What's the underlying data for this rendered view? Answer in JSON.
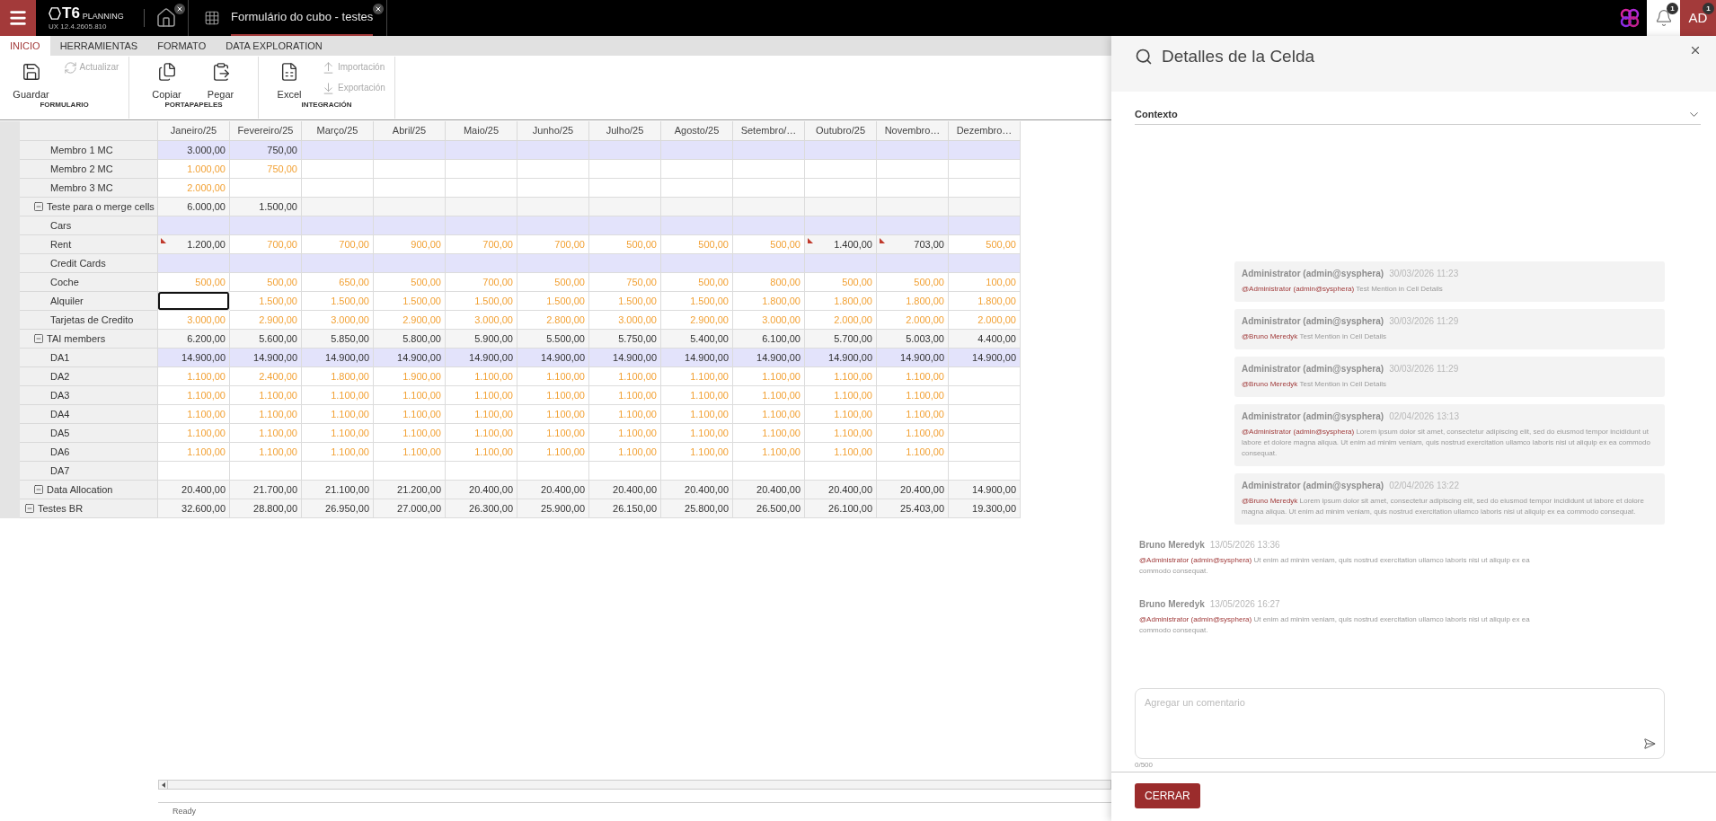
{
  "topbar": {
    "logo": {
      "mark": "T6",
      "name": "PLANNING",
      "version": "UX 12.4.2605.810"
    },
    "tabs": [
      {
        "kind": "home",
        "selected": false
      },
      {
        "kind": "form",
        "label": "Formulário do cubo - testes",
        "selected": true
      }
    ],
    "notifications": {
      "count": "1"
    },
    "user": {
      "initials": "AD",
      "count": "1"
    }
  },
  "ribbon": {
    "tabs": [
      {
        "label": "INICIO",
        "selected": true
      },
      {
        "label": "HERRAMIENTAS",
        "selected": false
      },
      {
        "label": "FORMATO",
        "selected": false
      },
      {
        "label": "DATA EXPLORATION",
        "selected": false
      }
    ],
    "groups": [
      {
        "label": "FORMULARIO",
        "buttons": [
          {
            "kind": "save",
            "label": "Guardar",
            "disabled": false
          },
          {
            "kind": "refresh",
            "label": "Actualizar",
            "disabled": true
          }
        ]
      },
      {
        "label": "PORTAPAPELES",
        "buttons": [
          {
            "kind": "copy",
            "label": "Copiar",
            "disabled": false
          },
          {
            "kind": "paste",
            "label": "Pegar",
            "disabled": false
          }
        ]
      },
      {
        "label": "INTEGRACIÓN",
        "buttons": [
          {
            "kind": "excel",
            "label": "Excel",
            "disabled": false
          },
          {
            "kind": "import",
            "label": "Importación",
            "disabled": true
          },
          {
            "kind": "export",
            "label": "Exportación",
            "disabled": true
          }
        ]
      }
    ]
  },
  "grid": {
    "columns": [
      "Janeiro/25",
      "Fevereiro/25",
      "Março/25",
      "Abril/25",
      "Maio/25",
      "Junho/25",
      "Julho/25",
      "Agosto/25",
      "Setembro/…",
      "Outubro/25",
      "Novembro…",
      "Dezembro…"
    ],
    "rows": [
      {
        "label": "Testes BR",
        "kind": "total",
        "expanded": true,
        "cells": [
          "32.600,00",
          "28.800,00",
          "26.950,00",
          "27.000,00",
          "26.300,00",
          "25.900,00",
          "26.150,00",
          "25.800,00",
          "26.500,00",
          "26.100,00",
          "25.403,00",
          "19.300,00"
        ],
        "selected": [
          false,
          false,
          false,
          false,
          false,
          false,
          false,
          false,
          false,
          false,
          false,
          false
        ],
        "children": [
          {
            "label": "Teste para o merge cells",
            "kind": "total",
            "expanded": true,
            "cells": [
              "6.000,00",
              "1.500,00",
              null,
              null,
              null,
              null,
              null,
              null,
              null,
              null,
              null,
              null
            ],
            "selected": [
              false,
              false,
              false,
              false,
              false,
              false,
              false,
              false,
              false,
              false,
              false,
              false
            ],
            "children": [
              {
                "label": "Membro 1 MC",
                "kind": "band",
                "cells": [
                  "3.000,00",
                  "750,00",
                  null,
                  null,
                  null,
                  null,
                  null,
                  null,
                  null,
                  null,
                  null,
                  null
                ],
                "selected": [
                  false,
                  false,
                  false,
                  false,
                  false,
                  false,
                  false,
                  false,
                  false,
                  false,
                  false,
                  false
                ]
              },
              {
                "label": "Membro 2 MC",
                "kind": "input",
                "cells": [
                  "1.000,00",
                  "750,00",
                  null,
                  null,
                  null,
                  null,
                  null,
                  null,
                  null,
                  null,
                  null,
                  null
                ],
                "selected": [
                  false,
                  false,
                  false,
                  false,
                  false,
                  false,
                  false,
                  false,
                  false,
                  false,
                  false,
                  false
                ]
              },
              {
                "label": "Membro 3 MC",
                "kind": "input",
                "cells": [
                  "2.000,00",
                  null,
                  null,
                  null,
                  null,
                  null,
                  null,
                  null,
                  null,
                  null,
                  null,
                  null
                ],
                "selected": [
                  false,
                  false,
                  false,
                  false,
                  false,
                  false,
                  false,
                  false,
                  false,
                  false,
                  false,
                  false
                ]
              }
            ]
          },
          {
            "label": "TAI members",
            "kind": "total",
            "expanded": true,
            "cells": [
              "6.200,00",
              "5.600,00",
              "5.850,00",
              "5.800,00",
              "5.900,00",
              "5.500,00",
              "5.750,00",
              "5.400,00",
              "6.100,00",
              "5.700,00",
              "5.003,00",
              "4.400,00"
            ],
            "selected": [
              false,
              false,
              false,
              false,
              false,
              false,
              false,
              false,
              false,
              false,
              false,
              false
            ],
            "children": [
              {
                "label": "Cars",
                "kind": "band",
                "cells": [
                  null,
                  null,
                  null,
                  null,
                  null,
                  null,
                  null,
                  null,
                  null,
                  null,
                  null,
                  null
                ],
                "selected": [
                  false,
                  false,
                  false,
                  false,
                  false,
                  false,
                  false,
                  false,
                  false,
                  false,
                  false,
                  false
                ]
              },
              {
                "label": "Rent",
                "kind": "input",
                "cells": [
                  "1.200,00",
                  "700,00",
                  "700,00",
                  "900,00",
                  "700,00",
                  "700,00",
                  "500,00",
                  "500,00",
                  "500,00",
                  "1.400,00",
                  "703,00",
                  "500,00"
                ],
                "selected": [
                  false,
                  false,
                  false,
                  false,
                  false,
                  false,
                  false,
                  false,
                  false,
                  false,
                  false,
                  false
                ],
                "comments": [
                  true,
                  false,
                  false,
                  false,
                  false,
                  false,
                  false,
                  false,
                  false,
                  true,
                  true,
                  false
                ]
              },
              {
                "label": "Credit Cards",
                "kind": "band",
                "cells": [
                  null,
                  null,
                  null,
                  null,
                  null,
                  null,
                  null,
                  null,
                  null,
                  null,
                  null,
                  null
                ],
                "selected": [
                  false,
                  false,
                  false,
                  false,
                  false,
                  false,
                  false,
                  false,
                  false,
                  false,
                  false,
                  false
                ]
              },
              {
                "label": "Coche",
                "kind": "input",
                "cells": [
                  "500,00",
                  "500,00",
                  "650,00",
                  "500,00",
                  "700,00",
                  "500,00",
                  "750,00",
                  "500,00",
                  "800,00",
                  "500,00",
                  "500,00",
                  "100,00"
                ],
                "selected": [
                  false,
                  false,
                  false,
                  false,
                  false,
                  false,
                  false,
                  false,
                  false,
                  false,
                  false,
                  false
                ]
              },
              {
                "label": "Alquiler",
                "kind": "input",
                "cells": [
                  null,
                  "1.500,00",
                  "1.500,00",
                  "1.500,00",
                  "1.500,00",
                  "1.500,00",
                  "1.500,00",
                  "1.500,00",
                  "1.800,00",
                  "1.800,00",
                  "1.800,00",
                  "1.800,00"
                ],
                "selected": [
                  true,
                  false,
                  false,
                  false,
                  false,
                  false,
                  false,
                  false,
                  false,
                  false,
                  false,
                  false
                ]
              },
              {
                "label": "Tarjetas de Credito",
                "kind": "input",
                "cells": [
                  "3.000,00",
                  "2.900,00",
                  "3.000,00",
                  "2.900,00",
                  "3.000,00",
                  "2.800,00",
                  "3.000,00",
                  "2.900,00",
                  "3.000,00",
                  "2.000,00",
                  "2.000,00",
                  "2.000,00"
                ],
                "selected": [
                  false,
                  false,
                  false,
                  false,
                  false,
                  false,
                  false,
                  false,
                  false,
                  false,
                  false,
                  false
                ]
              }
            ]
          },
          {
            "label": "Data Allocation",
            "kind": "total",
            "expanded": true,
            "cells": [
              "20.400,00",
              "21.700,00",
              "21.100,00",
              "21.200,00",
              "20.400,00",
              "20.400,00",
              "20.400,00",
              "20.400,00",
              "20.400,00",
              "20.400,00",
              "20.400,00",
              "14.900,00"
            ],
            "selected": [
              false,
              false,
              false,
              false,
              false,
              false,
              false,
              false,
              false,
              false,
              false,
              false
            ],
            "children": [
              {
                "label": "DA1",
                "kind": "band",
                "cells": [
                  "14.900,00",
                  "14.900,00",
                  "14.900,00",
                  "14.900,00",
                  "14.900,00",
                  "14.900,00",
                  "14.900,00",
                  "14.900,00",
                  "14.900,00",
                  "14.900,00",
                  "14.900,00",
                  "14.900,00"
                ],
                "selected": [
                  false,
                  false,
                  false,
                  false,
                  false,
                  false,
                  false,
                  false,
                  false,
                  false,
                  false,
                  false
                ]
              },
              {
                "label": "DA2",
                "kind": "input",
                "cells": [
                  "1.100,00",
                  "2.400,00",
                  "1.800,00",
                  "1.900,00",
                  "1.100,00",
                  "1.100,00",
                  "1.100,00",
                  "1.100,00",
                  "1.100,00",
                  "1.100,00",
                  "1.100,00",
                  null
                ],
                "selected": [
                  false,
                  false,
                  false,
                  false,
                  false,
                  false,
                  false,
                  false,
                  false,
                  false,
                  false,
                  false
                ]
              },
              {
                "label": "DA3",
                "kind": "input",
                "cells": [
                  "1.100,00",
                  "1.100,00",
                  "1.100,00",
                  "1.100,00",
                  "1.100,00",
                  "1.100,00",
                  "1.100,00",
                  "1.100,00",
                  "1.100,00",
                  "1.100,00",
                  "1.100,00",
                  null
                ],
                "selected": [
                  false,
                  false,
                  false,
                  false,
                  false,
                  false,
                  false,
                  false,
                  false,
                  false,
                  false,
                  false
                ]
              },
              {
                "label": "DA4",
                "kind": "input",
                "cells": [
                  "1.100,00",
                  "1.100,00",
                  "1.100,00",
                  "1.100,00",
                  "1.100,00",
                  "1.100,00",
                  "1.100,00",
                  "1.100,00",
                  "1.100,00",
                  "1.100,00",
                  "1.100,00",
                  null
                ],
                "selected": [
                  false,
                  false,
                  false,
                  false,
                  false,
                  false,
                  false,
                  false,
                  false,
                  false,
                  false,
                  false
                ]
              },
              {
                "label": "DA5",
                "kind": "input",
                "cells": [
                  "1.100,00",
                  "1.100,00",
                  "1.100,00",
                  "1.100,00",
                  "1.100,00",
                  "1.100,00",
                  "1.100,00",
                  "1.100,00",
                  "1.100,00",
                  "1.100,00",
                  "1.100,00",
                  null
                ],
                "selected": [
                  false,
                  false,
                  false,
                  false,
                  false,
                  false,
                  false,
                  false,
                  false,
                  false,
                  false,
                  false
                ]
              },
              {
                "label": "DA6",
                "kind": "input",
                "cells": [
                  "1.100,00",
                  "1.100,00",
                  "1.100,00",
                  "1.100,00",
                  "1.100,00",
                  "1.100,00",
                  "1.100,00",
                  "1.100,00",
                  "1.100,00",
                  "1.100,00",
                  "1.100,00",
                  null
                ],
                "selected": [
                  false,
                  false,
                  false,
                  false,
                  false,
                  false,
                  false,
                  false,
                  false,
                  false,
                  false,
                  false
                ]
              },
              {
                "label": "DA7",
                "kind": "input",
                "cells": [
                  null,
                  null,
                  null,
                  null,
                  null,
                  null,
                  null,
                  null,
                  null,
                  null,
                  null,
                  null
                ],
                "selected": [
                  false,
                  false,
                  false,
                  false,
                  false,
                  false,
                  false,
                  false,
                  false,
                  false,
                  false,
                  false
                ]
              }
            ]
          }
        ]
      }
    ]
  },
  "status_bar": {
    "text": "Ready"
  },
  "panel": {
    "title": "Detalles de la Celda",
    "sections": [
      {
        "label": "Contexto",
        "expanded": false
      }
    ],
    "comments": [
      {
        "own": true,
        "author": "Administrator (admin@sysphera)",
        "date": "30/03/2026 11:23",
        "mention": "@Administrator (admin@sysphera)",
        "text": "Test Mention in Cell Details"
      },
      {
        "own": true,
        "author": "Administrator (admin@sysphera)",
        "date": "30/03/2026 11:29",
        "mention": "@Bruno Meredyk",
        "text": "Test Mention in Cell Details"
      },
      {
        "own": true,
        "author": "Administrator (admin@sysphera)",
        "date": "30/03/2026 11:29",
        "mention": "@Bruno Meredyk",
        "text": "Test Mention in Cell Details"
      },
      {
        "own": true,
        "author": "Administrator (admin@sysphera)",
        "date": "02/04/2026 13:13",
        "mention": "@Administrator (admin@sysphera)",
        "text": "Lorem ipsum dolor sit amet, consectetur adipiscing elit, sed do eiusmod tempor incididunt ut labore et dolore magna aliqua. Ut enim ad minim veniam, quis nostrud exercitation ullamco laboris nisi ut aliquip ex ea commodo consequat."
      },
      {
        "own": true,
        "author": "Administrator (admin@sysphera)",
        "date": "02/04/2026 13:22",
        "mention": "@Bruno Meredyk",
        "text": "Lorem ipsum dolor sit amet, consectetur adipiscing elit, sed do eiusmod tempor incididunt ut labore et dolore magna aliqua. Ut enim ad minim veniam, quis nostrud exercitation ullamco laboris nisi ut aliquip ex ea commodo consequat."
      },
      {
        "own": false,
        "author": "Bruno Meredyk",
        "date": "13/05/2026 13:36",
        "mention": "@Administrator (admin@sysphera)",
        "text": "Ut enim ad minim veniam, quis nostrud exercitation ullamco laboris nisi ut aliquip ex ea commodo consequat."
      },
      {
        "own": false,
        "author": "Bruno Meredyk",
        "date": "13/05/2026 16:27",
        "mention": "@Administrator (admin@sysphera)",
        "text": "Ut enim ad minim veniam, quis nostrud exercitation ullamco laboris nisi ut aliquip ex ea commodo consequat."
      }
    ],
    "composer": {
      "placeholder": "Agregar un comentario",
      "counter": "0/500"
    },
    "close_button": "CERRAR"
  }
}
